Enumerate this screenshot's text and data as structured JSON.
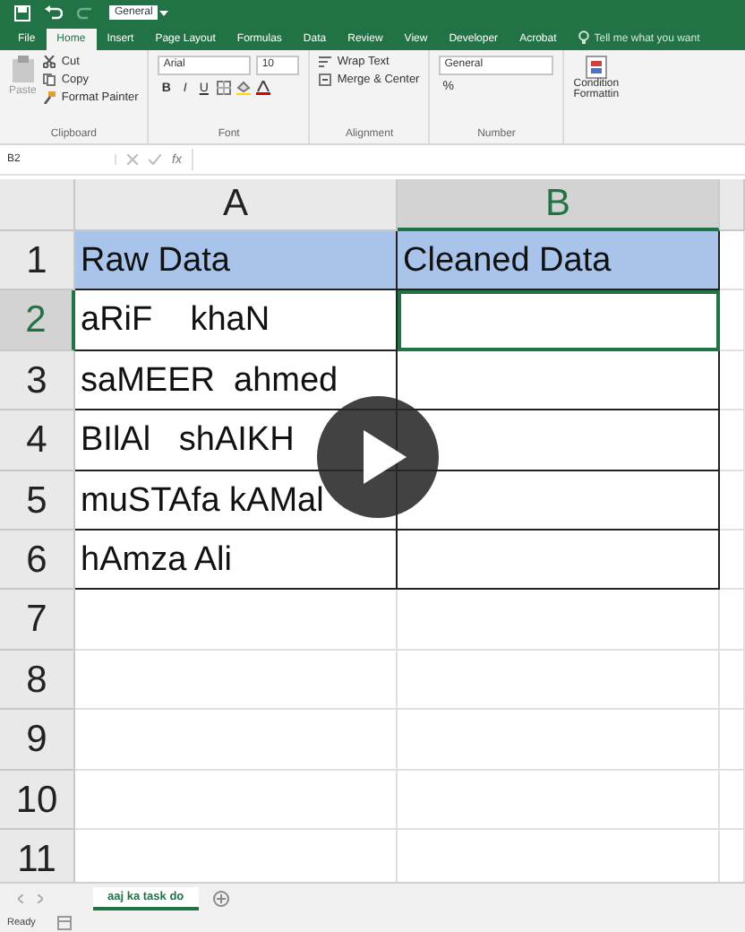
{
  "quick_access": {
    "format": "General"
  },
  "ribbon_tabs": [
    {
      "label": "File",
      "selected": false
    },
    {
      "label": "Home",
      "selected": true
    },
    {
      "label": "Insert",
      "selected": false
    },
    {
      "label": "Page Layout",
      "selected": false
    },
    {
      "label": "Formulas",
      "selected": false
    },
    {
      "label": "Data",
      "selected": false
    },
    {
      "label": "Review",
      "selected": false
    },
    {
      "label": "View",
      "selected": false
    },
    {
      "label": "Developer",
      "selected": false
    },
    {
      "label": "Acrobat",
      "selected": false
    }
  ],
  "tell_me": "Tell me what you want",
  "clipboard": {
    "paste": "Paste",
    "cut": "Cut",
    "copy": "Copy",
    "format_painter": "Format Painter",
    "label": "Clipboard"
  },
  "font": {
    "family": "Arial",
    "size": "10",
    "bold": "B",
    "italic": "I",
    "underline": "U",
    "label": "Font"
  },
  "alignment": {
    "wrap": "Wrap Text",
    "merge": "Merge & Center",
    "label": "Alignment"
  },
  "number": {
    "format": "General",
    "percent": "%",
    "label": "Number"
  },
  "styles": {
    "conditional": [
      "Condition",
      "Formattin"
    ]
  },
  "name_box": "B2",
  "fx": "fx",
  "columns": [
    {
      "label": "A",
      "selected": false
    },
    {
      "label": "B",
      "selected": true
    }
  ],
  "rows": [
    {
      "number": "1",
      "selected": false,
      "filled": true,
      "bordered": true,
      "cells": [
        {
          "text": "Raw Data",
          "active": false
        },
        {
          "text": "Cleaned Data",
          "active": false
        }
      ]
    },
    {
      "number": "2",
      "selected": true,
      "filled": false,
      "bordered": true,
      "cells": [
        {
          "text": "aRiF    khaN",
          "active": false
        },
        {
          "active": true
        }
      ]
    },
    {
      "number": "3",
      "selected": false,
      "filled": false,
      "bordered": true,
      "cells": [
        {
          "text": "saMEER  ahmed",
          "active": false
        },
        {
          "active": false
        }
      ]
    },
    {
      "number": "4",
      "selected": false,
      "filled": false,
      "bordered": true,
      "cells": [
        {
          "text": "BIlAl   shAIKH",
          "active": false
        },
        {
          "active": false
        }
      ]
    },
    {
      "number": "5",
      "selected": false,
      "filled": false,
      "bordered": true,
      "cells": [
        {
          "text": "muSTAfa kAMal",
          "active": false
        },
        {
          "active": false
        }
      ]
    },
    {
      "number": "6",
      "selected": false,
      "filled": false,
      "bordered": true,
      "cells": [
        {
          "text": "hAmza Ali",
          "active": false
        },
        {
          "active": false
        }
      ]
    },
    {
      "number": "7",
      "selected": false,
      "filled": false,
      "bordered": false,
      "cells": [
        {
          "active": false
        },
        {
          "active": false
        }
      ]
    },
    {
      "number": "8",
      "selected": false,
      "filled": false,
      "bordered": false,
      "cells": [
        {
          "active": false
        },
        {
          "active": false
        }
      ]
    },
    {
      "number": "9",
      "selected": false,
      "filled": false,
      "bordered": false,
      "cells": [
        {
          "active": false
        },
        {
          "active": false
        }
      ]
    },
    {
      "number": "10",
      "selected": false,
      "filled": false,
      "bordered": false,
      "cells": [
        {
          "active": false
        },
        {
          "active": false
        }
      ]
    },
    {
      "number": "11",
      "selected": false,
      "filled": false,
      "bordered": false,
      "cells": [
        {
          "active": false
        },
        {
          "active": false
        }
      ]
    }
  ],
  "sheet_tabs": [
    {
      "label": "aaj ka task do",
      "selected": true
    }
  ],
  "status": "Ready",
  "video_overlay": {
    "kind": "play"
  }
}
